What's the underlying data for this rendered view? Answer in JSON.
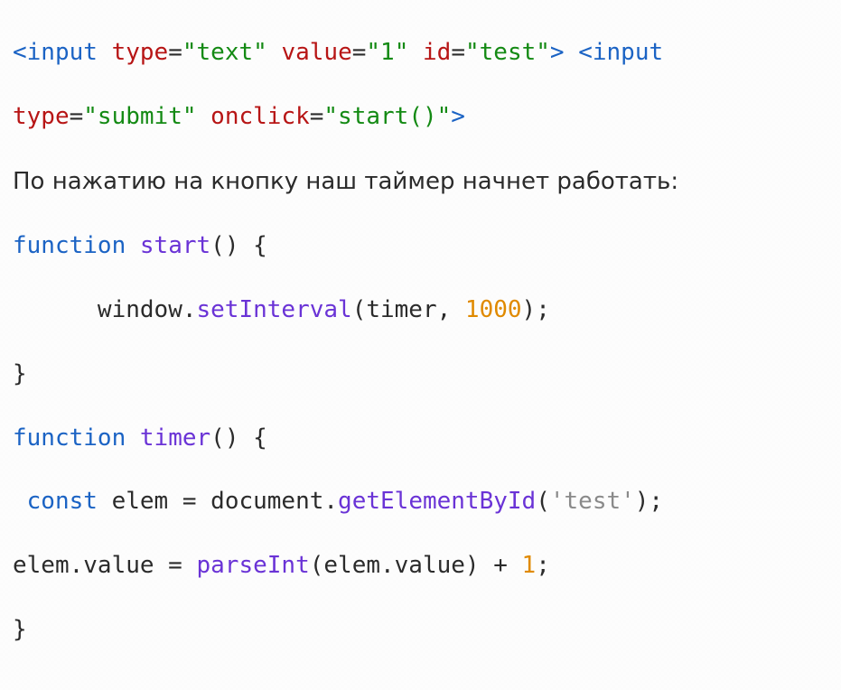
{
  "code": {
    "html_line1": {
      "open1": "<",
      "tag1": "input",
      "sp1": " ",
      "a_type": "type",
      "eq": "=",
      "v_text": "\"text\"",
      "sp2": " ",
      "a_value": "value",
      "v_1": "\"1\"",
      "sp3": " ",
      "a_id": "id",
      "v_test": "\"test\"",
      "close1": ">",
      "gap": " ",
      "open2": "<",
      "tag2": "input"
    },
    "html_line2": {
      "a_type": "type",
      "eq": "=",
      "v_submit": "\"submit\"",
      "sp": " ",
      "a_onclick": "onclick",
      "v_start": "\"start()\"",
      "close": ">"
    },
    "prose": "По нажатию на кнопку наш таймер начнет работать:",
    "fn1_l1": {
      "kw": "function",
      "sp": " ",
      "name": "start",
      "rest": "() {"
    },
    "fn1_l2": {
      "indent": "      ",
      "obj": "window.",
      "call": "setInterval",
      "open": "(",
      "arg1": "timer, ",
      "num": "1000",
      "close": ");"
    },
    "fn1_l3": "}",
    "fn2_l1": {
      "kw": "function",
      "sp": " ",
      "name": "timer",
      "rest": "() {"
    },
    "fn2_l2": {
      "indent": " ",
      "kw": "const",
      "mid": " elem = document.",
      "call": "getElementById",
      "open": "(",
      "lit": "'test'",
      "close": ");"
    },
    "fn2_l3": {
      "lhs": "elem.value = ",
      "call": "parseInt",
      "mid": "(elem.value) + ",
      "num": "1",
      "tail": ";"
    },
    "fn2_l4": "}"
  }
}
